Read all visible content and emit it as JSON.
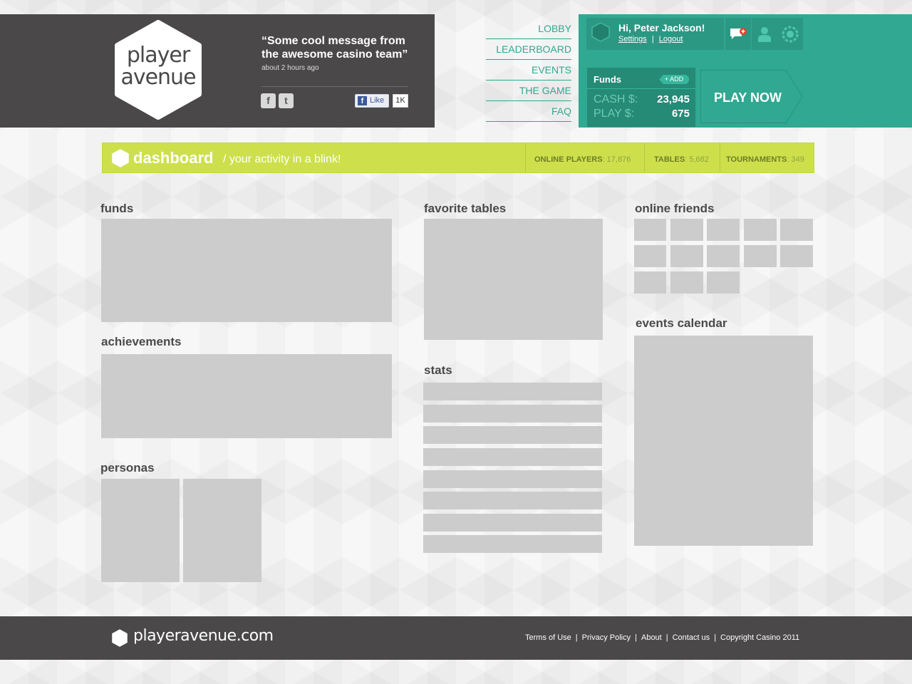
{
  "brand": {
    "logo_line1": "player",
    "logo_line2": "avenue",
    "quote": "“Some cool message from the awesome casino team”",
    "quote_time": "about 2 hours ago",
    "facebook_icon": "f",
    "twitter_icon": "t",
    "like_label": "Like",
    "like_count": "1K"
  },
  "nav": {
    "items": [
      "LOBBY",
      "LEADERBOARD",
      "EVENTS",
      "THE GAME",
      "FAQ"
    ]
  },
  "user": {
    "greeting": "Hi, Peter Jackson!",
    "settings_label": "Settings",
    "separator": "|",
    "logout_label": "Logout",
    "icons": [
      "chat-add-icon",
      "user-icon",
      "chip-icon"
    ]
  },
  "funds_panel": {
    "title": "Funds",
    "add_label": "+ ADD",
    "cash_label": "CASH $:",
    "cash_value": "23,945",
    "play_label": "PLAY $:",
    "play_value": "675",
    "play_now_label": "PLAY NOW"
  },
  "dashboard": {
    "title": "dashboard",
    "subtitle": "/ your activity in a blink!",
    "online_players_label": "ONLINE PLAYERS",
    "online_players_value": ": 17,876",
    "tables_label": "TABLES",
    "tables_value": ": 5,682",
    "tournaments_label": "TOURNAMENTS",
    "tournaments_value": ": 349"
  },
  "sections": {
    "funds": "funds",
    "achievements": "achievements",
    "personas": "personas",
    "favorite_tables": "favorite tables",
    "stats": "stats",
    "online_friends": "online friends",
    "events_calendar": "events calendar"
  },
  "footer": {
    "brand": "playeravenue.com",
    "terms": "Terms of Use",
    "privacy": "Privacy Policy",
    "about": "About",
    "contact": "Contact us",
    "copyright": "Copyright Casino 2011",
    "separator": "|"
  },
  "colors": {
    "dark": "#4a4848",
    "teal": "#31a892",
    "lime": "#cde04c",
    "placeholder": "#cccccc"
  }
}
